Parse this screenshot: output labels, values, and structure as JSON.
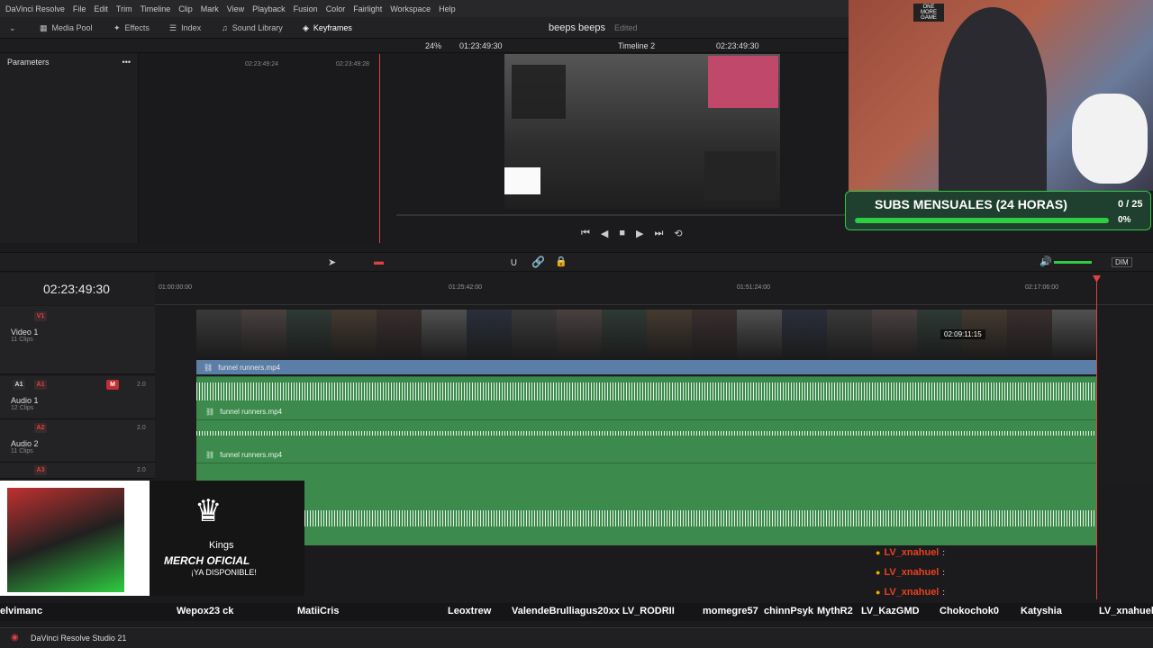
{
  "menu": [
    "DaVinci Resolve",
    "File",
    "Edit",
    "Trim",
    "Timeline",
    "Clip",
    "Mark",
    "View",
    "Playback",
    "Fusion",
    "Color",
    "Fairlight",
    "Workspace",
    "Help"
  ],
  "toolbar": {
    "media_pool": "Media Pool",
    "effects": "Effects",
    "index": "Index",
    "sound_library": "Sound Library",
    "keyframes": "Keyframes",
    "project_title": "beeps beeps",
    "project_status": "Edited",
    "zoom": "24%",
    "source_tc": "01:23:49:30",
    "timeline_name": "Timeline 2",
    "record_tc": "02:23:49:30"
  },
  "left_panel": {
    "title": "Parameters",
    "ruler": [
      "02:23:49:24",
      "02:23:49:28"
    ]
  },
  "timeline": {
    "current_tc": "02:23:49:30",
    "ruler": [
      "01:00:00:00",
      "01:25:42:00",
      "01:51:24:00",
      "02:17:06:00"
    ],
    "hover_tc": "02:09:11:15",
    "dim_label": "DIM",
    "tracks": [
      {
        "id": "V1",
        "name": "Video 1",
        "clips": "11 Clips",
        "clip_name": "funnel runners.mp4"
      },
      {
        "id": "A1",
        "name": "Audio 1",
        "clips": "12 Clips",
        "level": "2.0",
        "clip_name": "funnel runners.mp4"
      },
      {
        "id": "A2",
        "name": "Audio 2",
        "clips": "11 Clips",
        "level": "2.0",
        "clip_name": "funnel runners.mp4"
      },
      {
        "id": "A3",
        "name": "",
        "clips": "",
        "level": "2.0"
      }
    ]
  },
  "overlay": {
    "subs_title": "SUBS MENSUALES (24 HORAS)",
    "subs_count": "0 / 25",
    "subs_percent": "0%",
    "subs_progress": 0,
    "merch_brand": "Kings",
    "merch_line1": "MERCH OFICIAL",
    "merch_line2": "¡YA DISPONIBLE!",
    "chat": [
      {
        "user": "LV_xnahuel"
      },
      {
        "user": "LV_xnahuel"
      },
      {
        "user": "LV_xnahuel"
      }
    ],
    "names": [
      "elvimanc",
      "Wepox23 ck",
      "MatiiCris",
      "Leoxtrew",
      "ValendeBrulliagus20xx LV_RODRII",
      "momegre57",
      "chinnPsyk",
      "MythR2",
      "LV_KazGMD",
      "Chokochok0",
      "Katyshia",
      "LV_xnahuel"
    ],
    "webcam_sign": "ONE MORE GAME"
  },
  "taskbar": {
    "app_label": "DaVinci Resolve Studio 21"
  },
  "colors": {
    "accent_red": "#e04040",
    "audio_green": "#3c8a4c",
    "video_blue": "#5a7ea6",
    "subs_green": "#2ecc40"
  }
}
